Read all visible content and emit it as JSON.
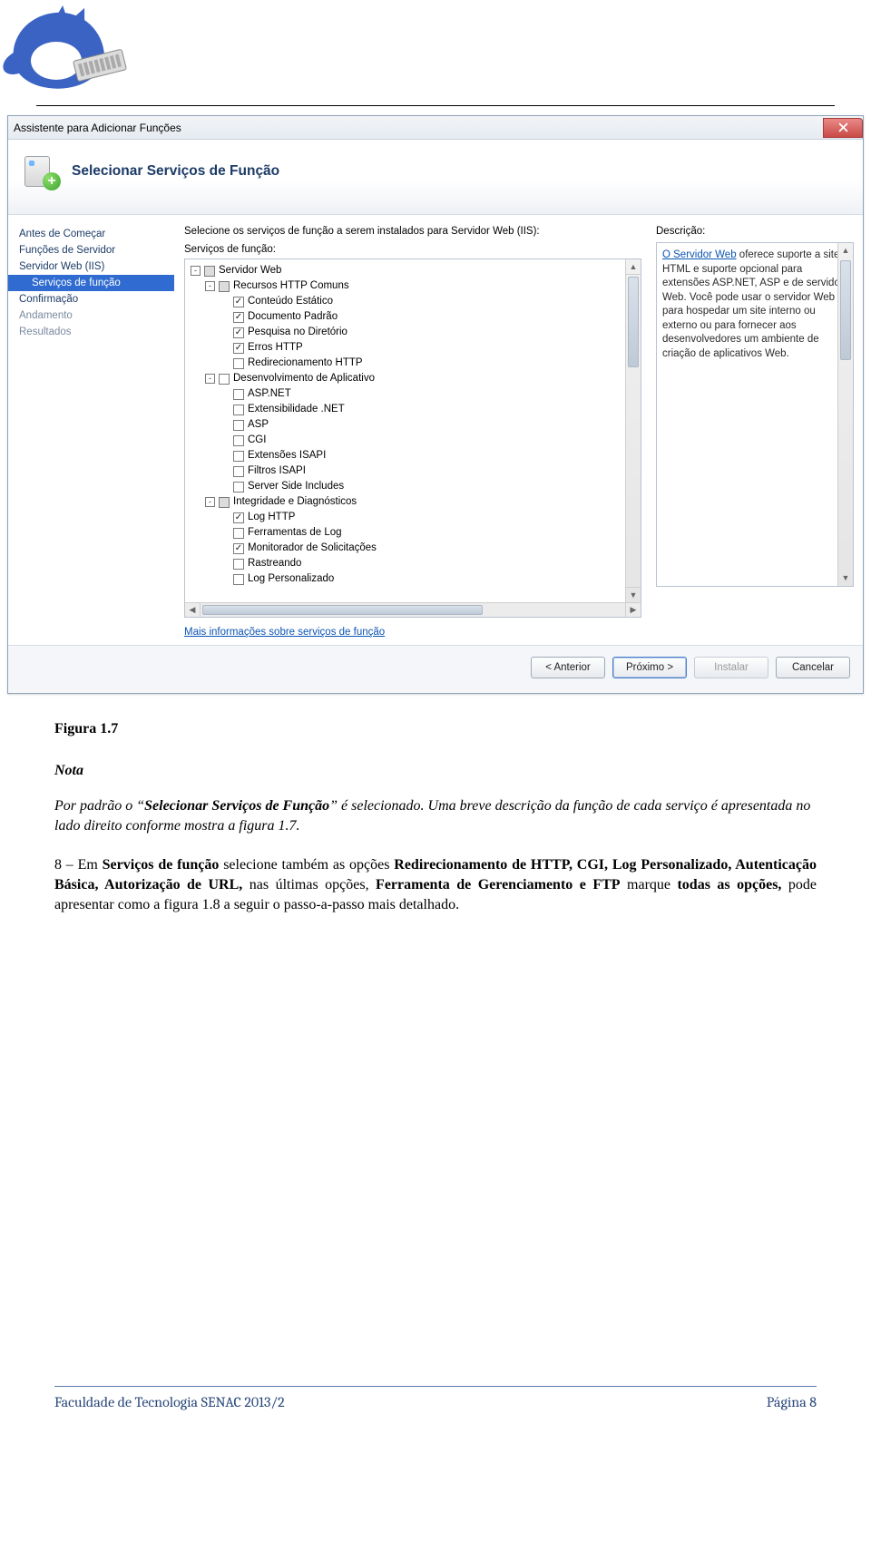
{
  "dialog": {
    "title": "Assistente para Adicionar Funções",
    "banner_heading": "Selecionar Serviços de Função",
    "nav": {
      "items": [
        {
          "label": "Antes de Começar",
          "cls": ""
        },
        {
          "label": "Funções de Servidor",
          "cls": ""
        },
        {
          "label": "Servidor Web (IIS)",
          "cls": ""
        },
        {
          "label": "Serviços de função",
          "cls": "sub selected"
        },
        {
          "label": "Confirmação",
          "cls": ""
        },
        {
          "label": "Andamento",
          "cls": "dim"
        },
        {
          "label": "Resultados",
          "cls": "dim"
        }
      ]
    },
    "instruction": "Selecione os serviços de função a serem instalados para Servidor Web (IIS):",
    "list_label": "Serviços de função:",
    "desc_label": "Descrição:",
    "desc_link": "O Servidor Web",
    "desc_text": " oferece suporte a sites HTML e suporte opcional para extensões ASP.NET, ASP e de servidor Web. Você pode usar o servidor Web para hospedar um site interno ou externo ou para fornecer aos desenvolvedores um ambiente de criação de aplicativos Web.",
    "more_link": "Mais informações sobre serviços de função",
    "tree": [
      {
        "ind": 0,
        "exp": "-",
        "chk": "tri",
        "label": "Servidor Web"
      },
      {
        "ind": 1,
        "exp": "-",
        "chk": "tri",
        "label": "Recursos HTTP Comuns"
      },
      {
        "ind": 2,
        "exp": "",
        "chk": "checked",
        "label": "Conteúdo Estático"
      },
      {
        "ind": 2,
        "exp": "",
        "chk": "checked",
        "label": "Documento Padrão"
      },
      {
        "ind": 2,
        "exp": "",
        "chk": "checked",
        "label": "Pesquisa no Diretório"
      },
      {
        "ind": 2,
        "exp": "",
        "chk": "checked",
        "label": "Erros HTTP"
      },
      {
        "ind": 2,
        "exp": "",
        "chk": "",
        "label": "Redirecionamento HTTP"
      },
      {
        "ind": 1,
        "exp": "-",
        "chk": "",
        "label": "Desenvolvimento de Aplicativo"
      },
      {
        "ind": 2,
        "exp": "",
        "chk": "",
        "label": "ASP.NET"
      },
      {
        "ind": 2,
        "exp": "",
        "chk": "",
        "label": "Extensibilidade .NET"
      },
      {
        "ind": 2,
        "exp": "",
        "chk": "",
        "label": "ASP"
      },
      {
        "ind": 2,
        "exp": "",
        "chk": "",
        "label": "CGI"
      },
      {
        "ind": 2,
        "exp": "",
        "chk": "",
        "label": "Extensões ISAPI"
      },
      {
        "ind": 2,
        "exp": "",
        "chk": "",
        "label": "Filtros ISAPI"
      },
      {
        "ind": 2,
        "exp": "",
        "chk": "",
        "label": "Server Side Includes"
      },
      {
        "ind": 1,
        "exp": "-",
        "chk": "tri",
        "label": "Integridade e Diagnósticos"
      },
      {
        "ind": 2,
        "exp": "",
        "chk": "checked",
        "label": "Log HTTP"
      },
      {
        "ind": 2,
        "exp": "",
        "chk": "",
        "label": "Ferramentas de Log"
      },
      {
        "ind": 2,
        "exp": "",
        "chk": "checked",
        "label": "Monitorador de Solicitações"
      },
      {
        "ind": 2,
        "exp": "",
        "chk": "",
        "label": "Rastreando"
      },
      {
        "ind": 2,
        "exp": "",
        "chk": "",
        "label": "Log Personalizado"
      }
    ],
    "buttons": {
      "prev": "< Anterior",
      "next": "Próximo >",
      "install": "Instalar",
      "cancel": "Cancelar"
    }
  },
  "copy": {
    "figure_caption": "Figura 1.7",
    "nota_heading": "Nota",
    "nota_body_prefix": "Por padrão o “",
    "nota_body_bold": "Selecionar Serviços de Função",
    "nota_body_suffix": "” é selecionado. Uma breve descrição da função de cada serviço é apresentada no lado direito conforme mostra a figura 1.7.",
    "step_prefix": "8 – Em ",
    "b1": "Serviços de função",
    "mid1": " selecione também as opções ",
    "b2": "Redirecionamento de HTTP, CGI, Log Personalizado, Autenticação Básica, Autorização de URL,",
    "mid2": " nas últimas opções, ",
    "b3": "Ferramenta de Gerenciamento e FTP",
    "mid3": " marque ",
    "b4": "todas as opções,",
    "suffix": " pode apresentar como a figura 1.8 a seguir o passo-a-passo mais detalhado."
  },
  "footer": {
    "left": "Faculdade de Tecnologia SENAC 2013/2",
    "right": "Página 8"
  }
}
